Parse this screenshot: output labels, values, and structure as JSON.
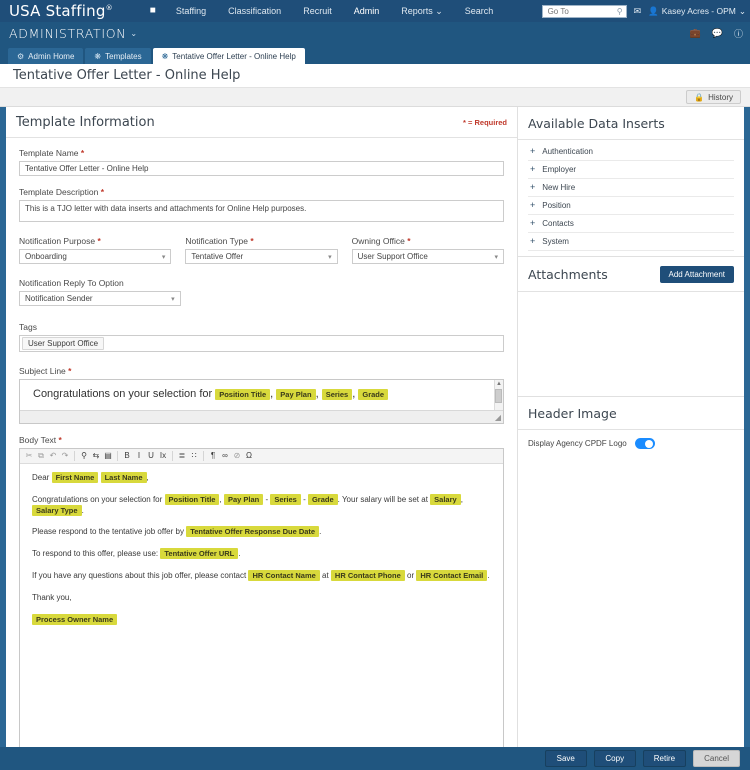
{
  "topnav": {
    "brand": "USA Staffing",
    "brand_sup": "®",
    "home_icon": "home-icon",
    "links": [
      {
        "label": "Staffing",
        "active": false
      },
      {
        "label": "Classification",
        "active": false
      },
      {
        "label": "Recruit",
        "active": false
      },
      {
        "label": "Admin",
        "active": true
      },
      {
        "label": "Reports ⌄",
        "active": false
      },
      {
        "label": "Search",
        "active": false
      }
    ],
    "goto_placeholder": "Go To",
    "goto_value": "",
    "mail_icon": "envelope-icon",
    "user_name": "Kasey Acres - OPM",
    "user_caret": "⌄"
  },
  "adminbar": {
    "title": "ADMINISTRATION",
    "caret": "⌄",
    "icons": [
      "briefcase-icon",
      "chat-icon",
      "help-icon"
    ]
  },
  "tabs": [
    {
      "label": "Admin Home",
      "icon": "gear-icon",
      "active": false
    },
    {
      "label": "Templates",
      "icon": "template-icon",
      "active": false
    },
    {
      "label": "Tentative Offer Letter - Online Help",
      "icon": "template-icon",
      "active": true
    }
  ],
  "page": {
    "title": "Tentative Offer Letter - Online Help",
    "history_label": "History",
    "history_icon": "lock-icon"
  },
  "template_information": {
    "heading": "Template Information",
    "required_note": "* = Required",
    "template_name": {
      "label": "Template Name",
      "required": "*",
      "value": "Tentative Offer Letter - Online Help"
    },
    "template_description": {
      "label": "Template Description",
      "required": "*",
      "value": "This is a TJO letter with data inserts and attachments for Online Help purposes."
    },
    "notification_purpose": {
      "label": "Notification Purpose",
      "required": "*",
      "value": "Onboarding"
    },
    "notification_type": {
      "label": "Notification Type",
      "required": "*",
      "value": "Tentative Offer"
    },
    "owning_office": {
      "label": "Owning Office",
      "required": "*",
      "value": "User Support Office"
    },
    "notification_reply_to": {
      "label": "Notification Reply To Option",
      "value": "Notification Sender"
    },
    "tags": {
      "label": "Tags",
      "chips": [
        "User Support Office"
      ]
    },
    "subject_line": {
      "label": "Subject Line",
      "required": "*",
      "prefix": "Congratulations on your selection for",
      "tokens": [
        "Position Title",
        "Pay Plan",
        "Series",
        "Grade"
      ],
      "sep": ","
    },
    "body_text": {
      "label": "Body Text",
      "required": "*",
      "toolbar": [
        {
          "name": "cut-icon",
          "glyph": "✂",
          "enabled": false
        },
        {
          "name": "copy-icon",
          "glyph": "⧉",
          "enabled": false
        },
        {
          "name": "undo-icon",
          "glyph": "↶",
          "enabled": false
        },
        {
          "name": "redo-icon",
          "glyph": "↷",
          "enabled": false
        },
        {
          "name": "find-icon",
          "glyph": "⚲",
          "enabled": true
        },
        {
          "name": "replace-icon",
          "glyph": "⇆",
          "enabled": true
        },
        {
          "name": "select-all-icon",
          "glyph": "▤",
          "enabled": true
        },
        {
          "name": "bold-icon",
          "glyph": "B",
          "enabled": true
        },
        {
          "name": "italic-icon",
          "glyph": "I",
          "enabled": true
        },
        {
          "name": "underline-icon",
          "glyph": "U",
          "enabled": true
        },
        {
          "name": "remove-format-icon",
          "glyph": "Ix",
          "enabled": true
        },
        {
          "name": "numbered-list-icon",
          "glyph": "≣",
          "enabled": true
        },
        {
          "name": "bulleted-list-icon",
          "glyph": "∷",
          "enabled": true
        },
        {
          "name": "paragraph-icon",
          "glyph": "¶",
          "enabled": true
        },
        {
          "name": "link-icon",
          "glyph": "∞",
          "enabled": true
        },
        {
          "name": "unlink-icon",
          "glyph": "⊘",
          "enabled": false
        },
        {
          "name": "special-char-icon",
          "glyph": "Ω",
          "enabled": true
        }
      ],
      "paragraphs": [
        {
          "segments": [
            {
              "t": "text",
              "v": "Dear "
            },
            {
              "t": "token",
              "v": "First Name"
            },
            {
              "t": "text",
              "v": " "
            },
            {
              "t": "token",
              "v": "Last Name"
            },
            {
              "t": "text",
              "v": ","
            }
          ]
        },
        {
          "segments": [
            {
              "t": "text",
              "v": "Congratulations on your selection for "
            },
            {
              "t": "token",
              "v": "Position Title"
            },
            {
              "t": "text",
              "v": ", "
            },
            {
              "t": "token",
              "v": "Pay Plan"
            },
            {
              "t": "text",
              "v": " - "
            },
            {
              "t": "token",
              "v": "Series"
            },
            {
              "t": "text",
              "v": " - "
            },
            {
              "t": "token",
              "v": "Grade"
            },
            {
              "t": "text",
              "v": ". Your salary will be set at "
            },
            {
              "t": "token",
              "v": "Salary"
            },
            {
              "t": "text",
              "v": ", "
            },
            {
              "t": "token",
              "v": "Salary Type"
            },
            {
              "t": "text",
              "v": "."
            }
          ]
        },
        {
          "segments": [
            {
              "t": "text",
              "v": "Please respond to the tentative job offer by "
            },
            {
              "t": "token",
              "v": "Tentative Offer Response Due Date"
            },
            {
              "t": "text",
              "v": "."
            }
          ]
        },
        {
          "segments": [
            {
              "t": "text",
              "v": "To respond to this offer, please use: "
            },
            {
              "t": "token",
              "v": "Tentative Offer URL"
            },
            {
              "t": "text",
              "v": "."
            }
          ]
        },
        {
          "segments": [
            {
              "t": "text",
              "v": "If you have any questions about this job offer, please contact "
            },
            {
              "t": "token",
              "v": "HR Contact Name"
            },
            {
              "t": "text",
              "v": " at "
            },
            {
              "t": "token",
              "v": "HR Contact Phone"
            },
            {
              "t": "text",
              "v": " or "
            },
            {
              "t": "token",
              "v": "HR Contact Email"
            },
            {
              "t": "text",
              "v": "."
            }
          ]
        },
        {
          "segments": [
            {
              "t": "text",
              "v": "Thank you,"
            }
          ]
        },
        {
          "segments": [
            {
              "t": "token",
              "v": "Process Owner Name"
            }
          ]
        }
      ]
    }
  },
  "available_data_inserts": {
    "heading": "Available Data Inserts",
    "items": [
      {
        "label": "Authentication"
      },
      {
        "label": "Employer"
      },
      {
        "label": "New Hire"
      },
      {
        "label": "Position"
      },
      {
        "label": "Contacts"
      },
      {
        "label": "System"
      }
    ]
  },
  "attachments": {
    "heading": "Attachments",
    "add_button": "Add Attachment"
  },
  "header_image": {
    "heading": "Header Image",
    "toggle_label": "Display Agency CPDF Logo",
    "toggle_on": true
  },
  "footer": {
    "buttons": [
      {
        "label": "Save",
        "style": "dark"
      },
      {
        "label": "Copy",
        "style": "dark"
      },
      {
        "label": "Retire",
        "style": "dark"
      },
      {
        "label": "Cancel",
        "style": "light"
      }
    ]
  },
  "colors": {
    "nav_dark": "#1f4e79",
    "nav_mid": "#205680",
    "tab_inactive": "#2b6795",
    "token_highlight": "#d8d93c",
    "toggle_on": "#1a8cff",
    "required_star": "#c0392b"
  }
}
